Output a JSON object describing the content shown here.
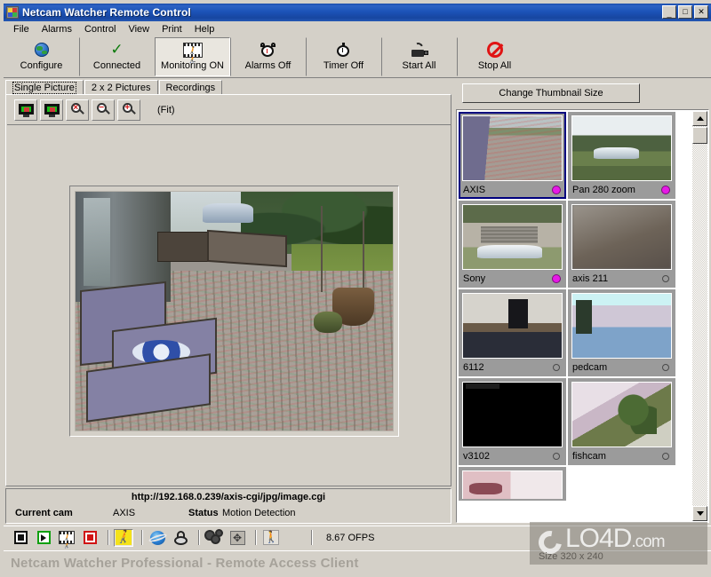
{
  "window": {
    "title": "Netcam Watcher Remote Control",
    "minimize_label": "_",
    "maximize_label": "□",
    "close_label": "✕"
  },
  "menu": {
    "items": [
      "File",
      "Alarms",
      "Control",
      "View",
      "Print",
      "Help"
    ]
  },
  "toolbar": {
    "buttons": [
      {
        "label": "Configure",
        "icon": "globe-icon",
        "pressed": false
      },
      {
        "label": "Connected",
        "icon": "check-icon",
        "pressed": false
      },
      {
        "label": "Monitoring ON",
        "icon": "motion-film-icon",
        "pressed": true
      },
      {
        "label": "Alarms Off",
        "icon": "alarm-clock-icon",
        "pressed": false
      },
      {
        "label": "Timer Off",
        "icon": "stopwatch-icon",
        "pressed": false
      },
      {
        "label": "Start All",
        "icon": "camera-icon",
        "pressed": false
      },
      {
        "label": "Stop All",
        "icon": "stop-sign-icon",
        "pressed": false
      }
    ]
  },
  "tabs": [
    {
      "label": "Single Picture",
      "active": true
    },
    {
      "label": "2 x 2 Pictures",
      "active": false
    },
    {
      "label": "Recordings",
      "active": false
    }
  ],
  "viewer": {
    "tools": [
      {
        "name": "fit-window-icon",
        "glyph": "monitor"
      },
      {
        "name": "actual-size-icon",
        "glyph": "monitor"
      },
      {
        "name": "zoom-reset-icon",
        "glyph": "x"
      },
      {
        "name": "zoom-out-icon",
        "glyph": "−"
      },
      {
        "name": "zoom-in-icon",
        "glyph": "+"
      }
    ],
    "zoom_label": "(Fit)"
  },
  "status": {
    "url": "http://192.168.0.239/axis-cgi/jpg/image.cgi",
    "current_cam_label": "Current cam",
    "current_cam_value": "AXIS",
    "status_label": "Status",
    "status_value": "Motion Detection"
  },
  "thumbnails": {
    "change_size_label": "Change Thumbnail Size",
    "items": [
      {
        "label": "AXIS",
        "selected": true,
        "indicator": "on",
        "scene": "porch"
      },
      {
        "label": "Pan 280 zoom",
        "selected": false,
        "indicator": "on",
        "scene": "drive"
      },
      {
        "label": "Sony",
        "selected": false,
        "indicator": "on",
        "scene": "garage"
      },
      {
        "label": "axis 211",
        "selected": false,
        "indicator": "off",
        "scene": "blur"
      },
      {
        "label": "6112",
        "selected": false,
        "indicator": "off",
        "scene": "room"
      },
      {
        "label": "pedcam",
        "selected": false,
        "indicator": "off",
        "scene": "bed"
      },
      {
        "label": "v3102",
        "selected": false,
        "indicator": "off",
        "scene": "black"
      },
      {
        "label": "fishcam",
        "selected": false,
        "indicator": "off",
        "scene": "fish"
      }
    ],
    "partial_item": {
      "label": "",
      "scene": "pink"
    }
  },
  "bottombar": {
    "buttons": [
      {
        "name": "stop-button",
        "active": false
      },
      {
        "name": "play-button",
        "active": false
      },
      {
        "name": "record-motion-button",
        "active": false
      },
      {
        "name": "record-button",
        "active": false
      },
      {
        "name": "motion-detect-button",
        "active": true
      },
      {
        "name": "browser-button",
        "active": false
      },
      {
        "name": "security-button",
        "active": false
      },
      {
        "name": "settings-button",
        "active": false
      },
      {
        "name": "pan-tilt-button",
        "active": false
      },
      {
        "name": "walk-detect-button",
        "active": false
      }
    ],
    "fps": "8.67 OFPS"
  },
  "footer": {
    "text": "Netcam Watcher Professional - Remote Access Client"
  },
  "watermark": {
    "brand": "LO4D",
    "tld": ".com",
    "size_text": "Size 320 x 240"
  }
}
